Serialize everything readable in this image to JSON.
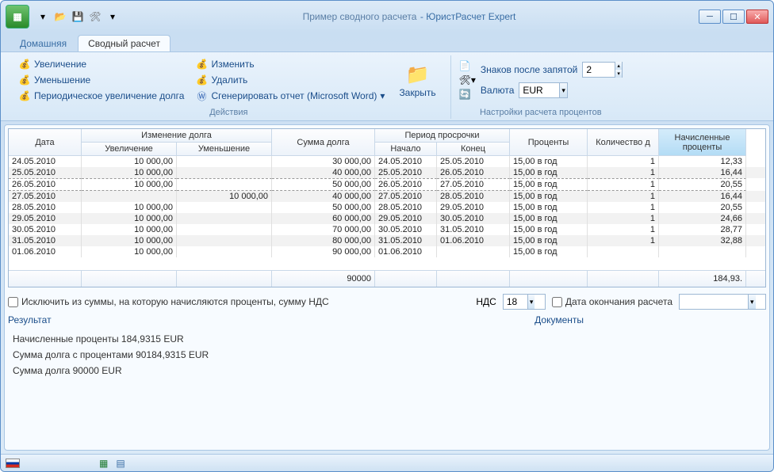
{
  "window": {
    "doc_title": "Пример сводного расчета",
    "app_title": "ЮристРасчет Expert"
  },
  "tabs": {
    "home": "Домашняя",
    "summary": "Сводный расчет"
  },
  "ribbon": {
    "actions": {
      "increase": "Увеличение",
      "decrease": "Уменьшение",
      "periodic": "Периодическое увеличение долга",
      "edit": "Изменить",
      "del": "Удалить",
      "gen_report": "Сгенерировать отчет (Microsoft Word)",
      "close": "Закрыть",
      "group_label": "Действия"
    },
    "settings": {
      "decimals_label": "Знаков после запятой",
      "decimals_value": "2",
      "currency_label": "Валюта",
      "currency_value": "EUR",
      "group_label": "Настройки расчета процентов"
    }
  },
  "grid": {
    "headers": {
      "date": "Дата",
      "debt_change": "Изменение долга",
      "increase": "Увеличение",
      "decrease": "Уменьшение",
      "debt_sum": "Сумма долга",
      "overdue_period": "Период просрочки",
      "start": "Начало",
      "end": "Конец",
      "interest": "Проценты",
      "qty": "Количество д",
      "accrued": "Начисленные проценты"
    },
    "rows": [
      {
        "date": "24.05.2010",
        "inc": "10 000,00",
        "dec": "",
        "sum": "30 000,00",
        "start": "24.05.2010",
        "end": "25.05.2010",
        "int": "15,00 в год",
        "qty": "1",
        "acc": "12,33",
        "dash": false
      },
      {
        "date": "25.05.2010",
        "inc": "10 000,00",
        "dec": "",
        "sum": "40 000,00",
        "start": "25.05.2010",
        "end": "26.05.2010",
        "int": "15,00 в год",
        "qty": "1",
        "acc": "16,44",
        "dash": false
      },
      {
        "date": "26.05.2010",
        "inc": "10 000,00",
        "dec": "",
        "sum": "50 000,00",
        "start": "26.05.2010",
        "end": "27.05.2010",
        "int": "15,00 в год",
        "qty": "1",
        "acc": "20,55",
        "dash": true
      },
      {
        "date": "27.05.2010",
        "inc": "",
        "dec": "10 000,00",
        "sum": "40 000,00",
        "start": "27.05.2010",
        "end": "28.05.2010",
        "int": "15,00 в год",
        "qty": "1",
        "acc": "16,44",
        "dash": false
      },
      {
        "date": "28.05.2010",
        "inc": "10 000,00",
        "dec": "",
        "sum": "50 000,00",
        "start": "28.05.2010",
        "end": "29.05.2010",
        "int": "15,00 в год",
        "qty": "1",
        "acc": "20,55",
        "dash": false
      },
      {
        "date": "29.05.2010",
        "inc": "10 000,00",
        "dec": "",
        "sum": "60 000,00",
        "start": "29.05.2010",
        "end": "30.05.2010",
        "int": "15,00 в год",
        "qty": "1",
        "acc": "24,66",
        "dash": false
      },
      {
        "date": "30.05.2010",
        "inc": "10 000,00",
        "dec": "",
        "sum": "70 000,00",
        "start": "30.05.2010",
        "end": "31.05.2010",
        "int": "15,00 в год",
        "qty": "1",
        "acc": "28,77",
        "dash": false
      },
      {
        "date": "31.05.2010",
        "inc": "10 000,00",
        "dec": "",
        "sum": "80 000,00",
        "start": "31.05.2010",
        "end": "01.06.2010",
        "int": "15,00 в год",
        "qty": "1",
        "acc": "32,88",
        "dash": false
      },
      {
        "date": "01.06.2010",
        "inc": "10 000,00",
        "dec": "",
        "sum": "90 000,00",
        "start": "01.06.2010",
        "end": "",
        "int": "15,00 в год",
        "qty": "",
        "acc": "",
        "dash": false
      }
    ],
    "footer": {
      "sum": "90000",
      "acc": "184,93."
    }
  },
  "options": {
    "exclude_vat": "Исключить из суммы, на которую начисляются проценты, сумму НДС",
    "vat_label": "НДС",
    "vat_value": "18",
    "end_date_label": "Дата окончания расчета",
    "result_label": "Результат",
    "documents_label": "Документы"
  },
  "results": {
    "line1": "Начисленные проценты 184,9315 EUR",
    "line2": "Сумма долга с процентами 90184,9315 EUR",
    "line3": "Сумма долга 90000 EUR"
  }
}
